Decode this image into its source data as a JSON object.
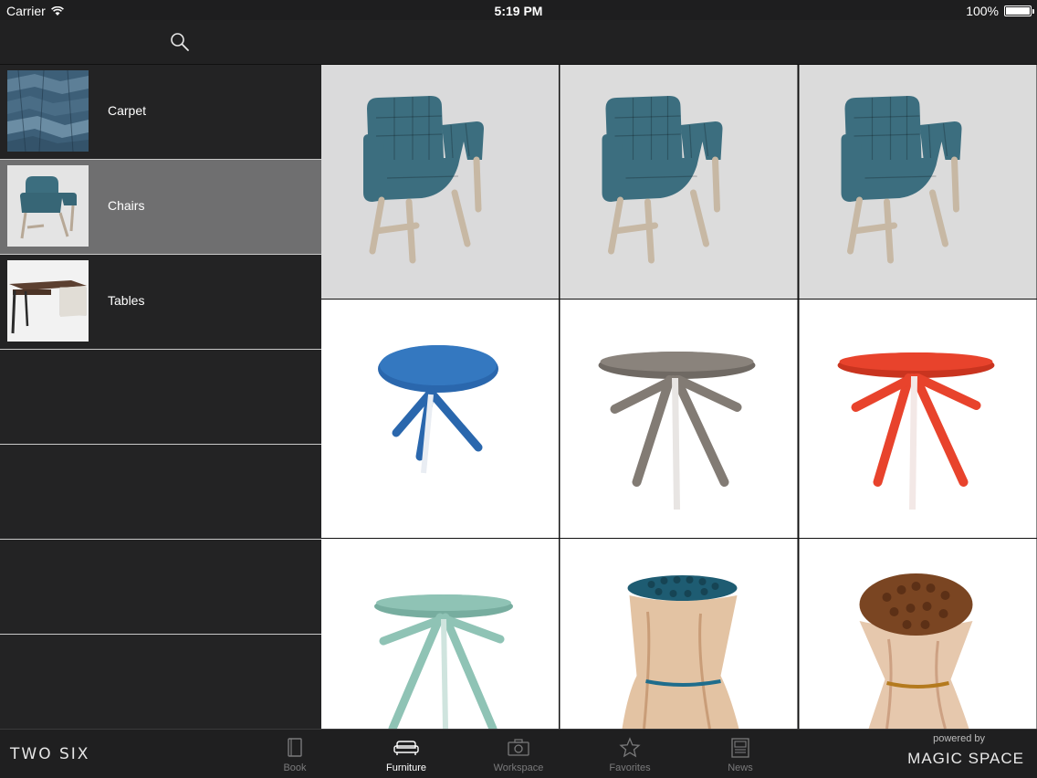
{
  "status_bar": {
    "carrier": "Carrier",
    "time": "5:19 PM",
    "battery": "100%"
  },
  "nav": {
    "search_icon": "search-icon"
  },
  "sidebar": {
    "items": [
      {
        "label": "Carpet",
        "icon": "carpet-thumbnail",
        "selected": false
      },
      {
        "label": "Chairs",
        "icon": "chair-thumbnail",
        "selected": true
      },
      {
        "label": "Tables",
        "icon": "desk-thumbnail",
        "selected": false
      },
      {
        "label": ""
      },
      {
        "label": ""
      },
      {
        "label": ""
      },
      {
        "label": ""
      }
    ]
  },
  "grid": {
    "products": [
      {
        "kind": "chair",
        "color": "#3c6e7f"
      },
      {
        "kind": "chair",
        "color": "#a8ab2e"
      },
      {
        "kind": "chair",
        "color": "#b83524"
      },
      {
        "kind": "round-table",
        "color": "#2a67ad"
      },
      {
        "kind": "round-table",
        "color": "#827b74"
      },
      {
        "kind": "round-table",
        "color": "#e8432c"
      },
      {
        "kind": "round-table",
        "color": "#8fc3b5"
      },
      {
        "kind": "wood-stool",
        "color": "#1e5c72"
      },
      {
        "kind": "wood-stool",
        "color": "#7a4522"
      }
    ]
  },
  "tab_bar": {
    "brand": "TWO SIX",
    "tabs": [
      {
        "label": "Book",
        "icon": "book-icon",
        "active": false
      },
      {
        "label": "Furniture",
        "icon": "sofa-icon",
        "active": true
      },
      {
        "label": "Workspace",
        "icon": "camera-icon",
        "active": false
      },
      {
        "label": "Favorites",
        "icon": "star-icon",
        "active": false
      },
      {
        "label": "News",
        "icon": "newspaper-icon",
        "active": false
      }
    ],
    "powered_by": "powered by",
    "powered_logo": "MAGIC SPACE"
  }
}
